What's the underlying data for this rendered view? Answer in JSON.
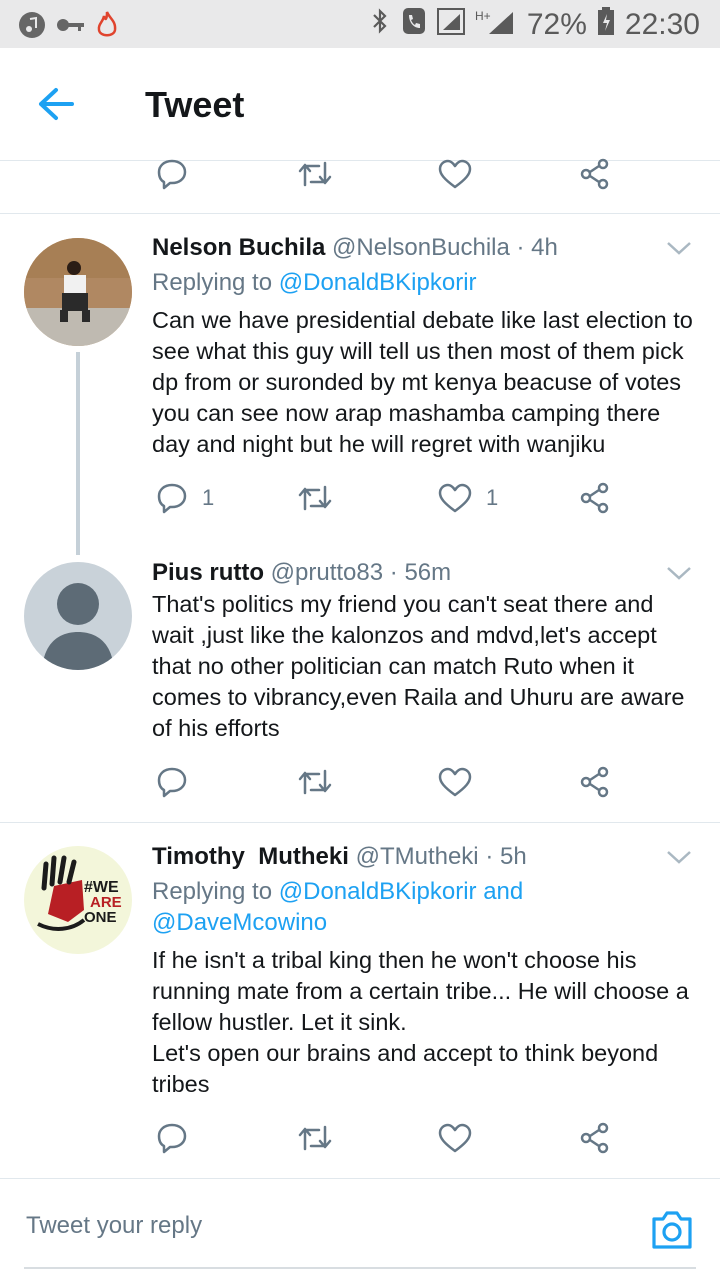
{
  "status_bar": {
    "battery": "72%",
    "time": "22:30"
  },
  "header": {
    "title": "Tweet"
  },
  "tweets": [
    {
      "name": "Nelson Buchila",
      "handle": "@NelsonBuchila",
      "time": "· 4h",
      "replying_label": "Replying to",
      "replying_to": "@DonaldBKipkorir",
      "text": "Can we have presidential debate like last election to see what this guy will tell us then most of them pick dp from or suronded by mt kenya beacuse of votes you can see now arap mashamba camping there day and night but he will regret with wanjiku",
      "reply_count": "1",
      "like_count": "1"
    },
    {
      "name": "Pius rutto",
      "handle": "@prutto83",
      "time": "· 56m",
      "text": "That's politics my friend you can't seat there and wait ,just like the kalonzos and mdvd,let's accept that no other politician can match Ruto when it comes to vibrancy,even Raila and Uhuru are aware of his efforts"
    },
    {
      "name": "Timothy  Mutheki",
      "handle": "@TMutheki",
      "time": "· 5h",
      "replying_label": "Replying to",
      "replying_to": "@DonaldBKipkorir and",
      "replying_to_2": "@DaveMcowino",
      "avatar_text": [
        "#WE",
        "ARE",
        "ONE"
      ],
      "text_line1": "If he isn't a tribal king then he won't choose his running mate from a certain tribe... He will choose a fellow hustler. Let it sink.",
      "text_line2": "Let's open our brains and accept to think beyond tribes"
    }
  ],
  "composer": {
    "placeholder": "Tweet your reply"
  },
  "colors": {
    "accent": "#1da1f2",
    "muted": "#657786",
    "text": "#14171a"
  }
}
